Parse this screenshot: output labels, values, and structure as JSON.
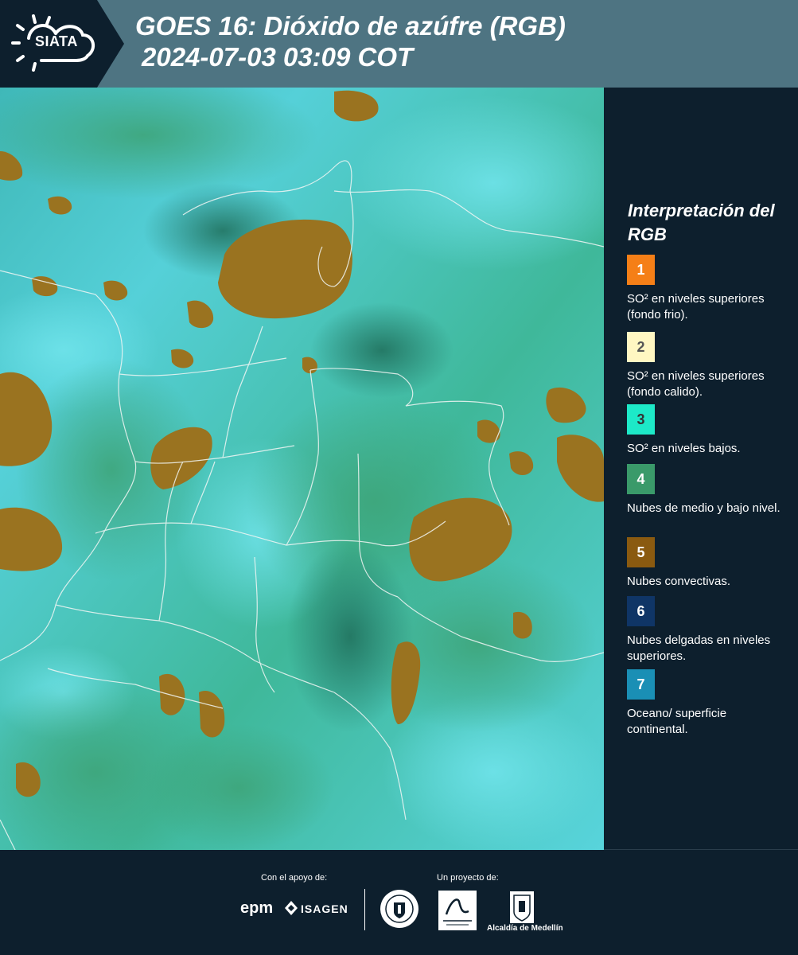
{
  "header": {
    "logo_text": "SIATA",
    "title_line1": "GOES 16: Dióxido de azúfre (RGB)",
    "title_line2": "2024-07-03 03:09 COT"
  },
  "legend": {
    "title": "Interpretación del RGB",
    "items": [
      {
        "number": "1",
        "color": "#f57f17",
        "text_color": "#ffffff",
        "description": "SO² en niveles superiores (fondo frio)."
      },
      {
        "number": "2",
        "color": "#fff7c2",
        "text_color": "#555555",
        "description": "SO² en niveles superiores (fondo calido)."
      },
      {
        "number": "3",
        "color": "#1de9c8",
        "text_color": "#333333",
        "description": "SO² en niveles bajos."
      },
      {
        "number": "4",
        "color": "#3a9a6a",
        "text_color": "#ffffff",
        "description": "Nubes de medio y bajo nivel."
      },
      {
        "number": "5",
        "color": "#8a5a10",
        "text_color": "#ffffff",
        "description": "Nubes convectivas."
      },
      {
        "number": "6",
        "color": "#0f3566",
        "text_color": "#ffffff",
        "description": "Nubes delgadas en niveles superiores."
      },
      {
        "number": "7",
        "color": "#1a8fb5",
        "text_color": "#ffffff",
        "description": "Oceano/ superficie continental."
      }
    ]
  },
  "footer": {
    "support_label": "Con el apoyo de:",
    "project_label": "Un proyecto de:",
    "epm": "epm",
    "isagen": "ISAGEN",
    "alcaldia": "Alcaldía de Medellín"
  }
}
